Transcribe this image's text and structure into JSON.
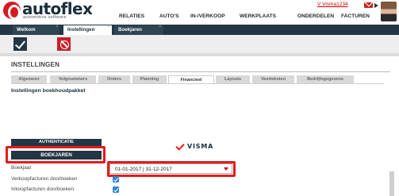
{
  "brand": {
    "name": "autoflex",
    "tagline": "automotive software"
  },
  "user": {
    "name": "V Visma1234"
  },
  "menu": [
    "RELATIES",
    "AUTO'S",
    "IN-/VERKOOP",
    "WERKPLAATS",
    "ONDERDELEN",
    "FACTUREN"
  ],
  "tabs": [
    {
      "label": "Welkom"
    },
    {
      "label": "Instellingen"
    },
    {
      "label": "Boekjaren"
    }
  ],
  "section": {
    "title": "INSTELLINGEN"
  },
  "subtabs": [
    "Algemeen",
    "Volgnummers",
    "Orders",
    "Planning",
    "Financieel",
    "Layouts",
    "Veettekoten",
    "Bedrijfsgegevens"
  ],
  "package": {
    "title": "Instellingen boekhoudpakket"
  },
  "buttons": {
    "authenticate": "AUTHENTICATIE",
    "boekjaren": "BOEKJAREN"
  },
  "visma": {
    "logo_text": "VISMA"
  },
  "form": {
    "boekjaar_label": "Boekjaar",
    "boekjaar_value": "01-01-2017 | 31-12-2017",
    "verkoop_label": "Verkoopfacturen doorboeken",
    "inkoop_label": "Inkoopfacturen doorboeken"
  },
  "colors": {
    "navy": "#233644",
    "brand_red": "#d61a20",
    "highlight_red": "#e51b1b",
    "checkbox_blue": "#2f86d6"
  }
}
